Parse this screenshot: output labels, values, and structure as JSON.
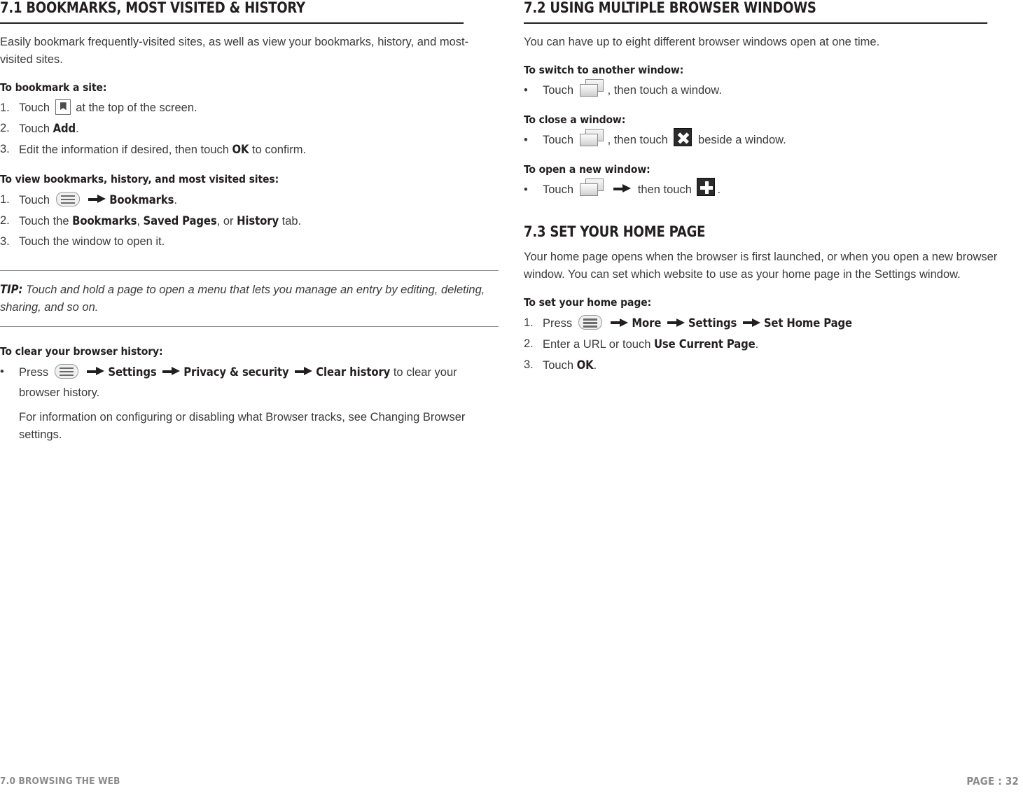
{
  "footer": {
    "left": "7.0 BROWSING THE WEB",
    "right": "PAGE : 32"
  },
  "left_column": {
    "section_title": "7.1 BOOKMARKS, MOST VISITED & HISTORY",
    "intro": "Easily bookmark frequently-visited sites, as well as view your bookmarks, history, and most-visited sites.",
    "bookmark_site": {
      "heading": "To bookmark a site:",
      "steps": [
        {
          "num": "1.",
          "pre": "Touch ",
          "icon": "bookmark-icon",
          "post": " at the top of the screen."
        },
        {
          "num": "2.",
          "pre": "Touch ",
          "bold": "Add",
          "post": "."
        },
        {
          "num": "3.",
          "pre": "Edit the information if desired, then touch ",
          "bold": "OK",
          "post": " to confirm."
        }
      ]
    },
    "view_bookmarks": {
      "heading": "To view bookmarks, history, and most visited sites:",
      "steps": [
        {
          "num": "1.",
          "pre": "Touch ",
          "icon": "menu-key-icon",
          "arrow": "arrow-icon",
          "bold": "Bookmarks",
          "post": "."
        },
        {
          "num": "2.",
          "pre": "Touch the ",
          "bold": "Bookmarks",
          "mid1": ", ",
          "bold2": "Saved Pages",
          "mid2": ", or ",
          "bold3": "History",
          "post": " tab."
        },
        {
          "num": "3.",
          "pre": "Touch the window to open it."
        }
      ]
    },
    "tip": {
      "label": "TIP:",
      "text": " Touch and hold a page to open a menu that lets you manage an entry by editing, deleting, sharing, and so on."
    },
    "clear_history": {
      "heading": "To clear your browser history:",
      "bullet": {
        "mark": "•",
        "pre": "Press ",
        "icon": "menu-key-icon",
        "arrow1": "arrow-icon",
        "bold1": "Settings",
        "arrow2": "arrow-icon",
        "bold2": "Privacy & security",
        "arrow3": "arrow-icon",
        "bold3": "Clear history",
        "post": " to clear your browser history."
      },
      "note": "For information on configuring or disabling what Browser tracks, see Changing Browser settings."
    }
  },
  "right_column": {
    "section_title_1": "7.2 USING MULTIPLE BROWSER WINDOWS",
    "intro_1": "You can have up to eight different browser windows open at one time.",
    "switch_window": {
      "heading": "To switch to another window:",
      "bullet": {
        "mark": "•",
        "pre": "Touch ",
        "icon": "windows-icon",
        "post": ", then touch a window."
      }
    },
    "close_window": {
      "heading": "To close a window:",
      "bullet": {
        "mark": "•",
        "pre": "Touch ",
        "icon": "windows-icon",
        "mid": ", then touch ",
        "icon2": "close-icon",
        "post": " beside a window."
      }
    },
    "open_window": {
      "heading": "To open a new window:",
      "bullet": {
        "mark": "•",
        "pre": "Touch ",
        "icon": "windows-icon",
        "arrow": "arrow-icon",
        "mid": " then touch ",
        "icon2": "plus-icon",
        "post": "."
      }
    },
    "section_title_2": "7.3 SET YOUR HOME PAGE",
    "intro_2": "Your home page opens when the browser is first launched, or when you open a new browser window. You can set which website to use as your home page in the Settings window.",
    "set_home": {
      "heading": "To set your home page:",
      "steps": [
        {
          "num": "1.",
          "pre": "Press ",
          "icon": "menu-key-icon",
          "arrow1": "arrow-icon",
          "bold1": "More",
          "arrow2": "arrow-icon",
          "bold2": "Settings",
          "arrow3": "arrow-icon",
          "bold3": "Set Home Page"
        },
        {
          "num": "2.",
          "pre": "Enter a URL or touch ",
          "bold": "Use Current Page",
          "post": "."
        },
        {
          "num": "3.",
          "pre": "Touch ",
          "bold": "OK",
          "post": "."
        }
      ]
    }
  },
  "colors": {
    "text": "#231f20",
    "body_text": "#3a3a3a",
    "rule": "#8d8d8d",
    "footer_text": "#8a8a8a"
  }
}
